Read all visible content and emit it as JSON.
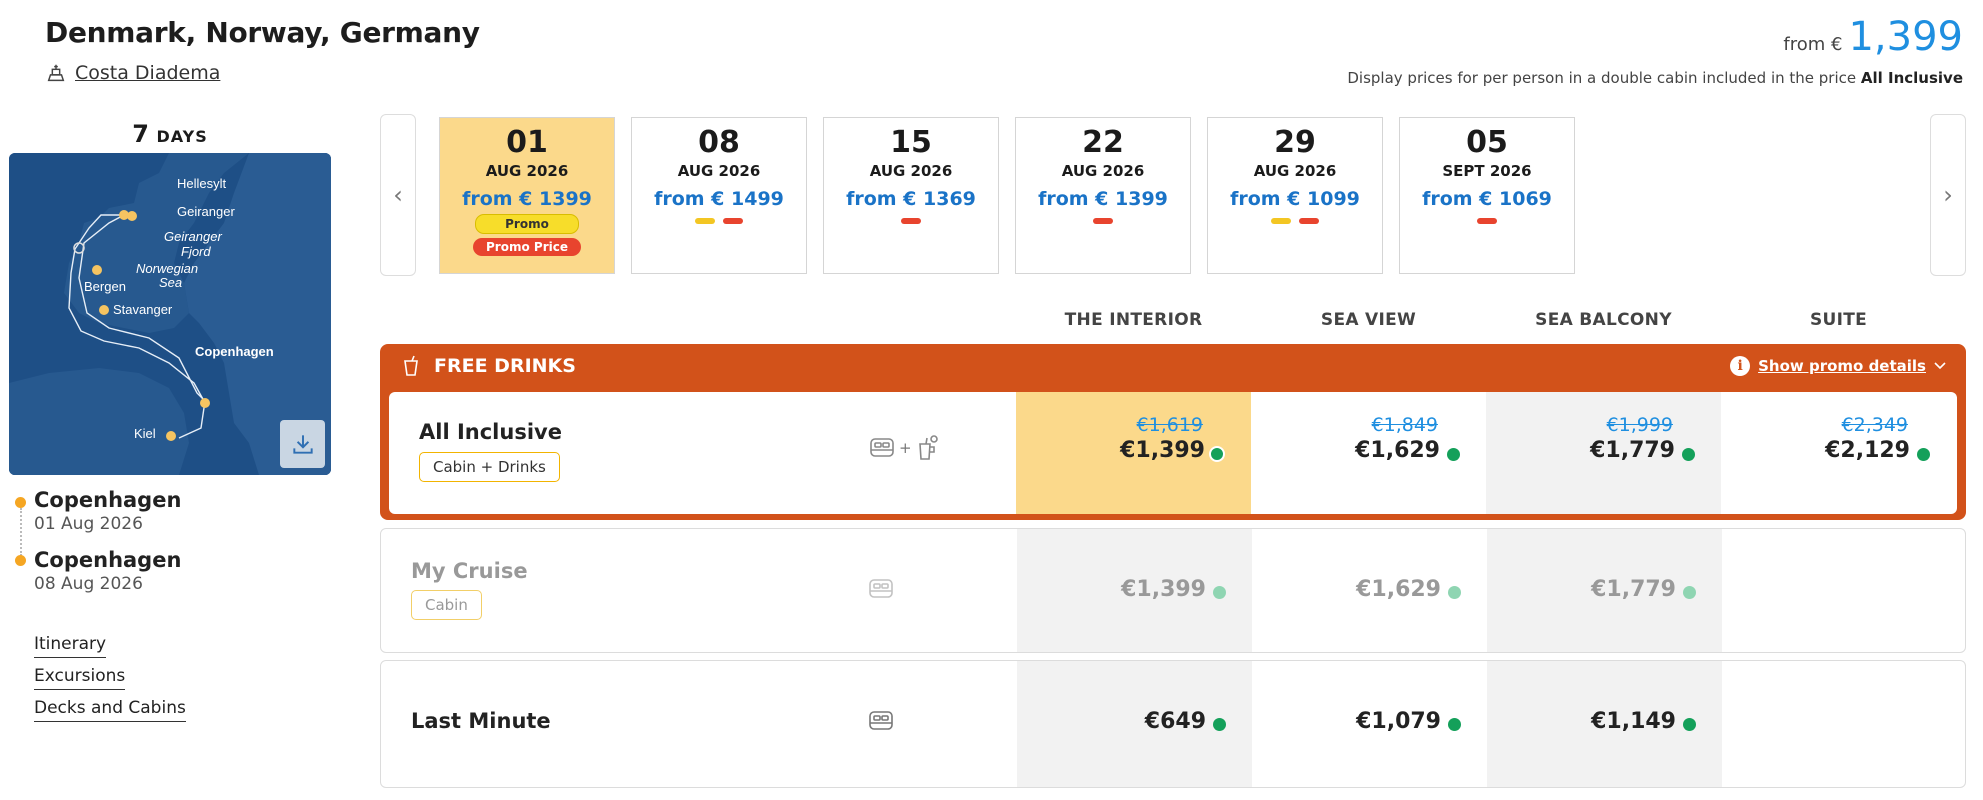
{
  "header": {
    "title": "Denmark, Norway, Germany",
    "ship": "Costa Diadema",
    "from_label": "from €",
    "from_amount": "1,399",
    "disclaimer": "Display prices for per person in a double cabin included in the price",
    "disclaimer_bold": "All Inclusive"
  },
  "sidebar": {
    "days_num": "7",
    "days_label": "DAYS",
    "map_labels": [
      "Hellesylt",
      "Geiranger",
      "Geiranger",
      "Fjord",
      "Norwegian",
      "Sea",
      "Bergen",
      "Stavanger",
      "Copenhagen",
      "Kiel"
    ],
    "departure": {
      "city": "Copenhagen",
      "date": "01 Aug 2026"
    },
    "arrival": {
      "city": "Copenhagen",
      "date": "08 Aug 2026"
    },
    "links": [
      "Itinerary",
      "Excursions",
      "Decks and Cabins"
    ]
  },
  "dates": [
    {
      "day": "01",
      "month": "AUG 2026",
      "price": "from € 1399",
      "promo": "Promo",
      "promo_price": "Promo Price",
      "active": true
    },
    {
      "day": "08",
      "month": "AUG 2026",
      "price": "from € 1499",
      "marks": [
        "y",
        "r"
      ]
    },
    {
      "day": "15",
      "month": "AUG 2026",
      "price": "from € 1369",
      "marks": [
        "r"
      ]
    },
    {
      "day": "22",
      "month": "AUG 2026",
      "price": "from € 1399",
      "marks": [
        "r"
      ]
    },
    {
      "day": "29",
      "month": "AUG 2026",
      "price": "from € 1099",
      "marks": [
        "y",
        "r"
      ]
    },
    {
      "day": "05",
      "month": "SEPT 2026",
      "price": "from € 1069",
      "marks": [
        "r"
      ]
    }
  ],
  "columns": [
    "THE INTERIOR",
    "SEA VIEW",
    "SEA BALCONY",
    "SUITE"
  ],
  "promo_block": {
    "title": "FREE DRINKS",
    "details_link": "Show promo details"
  },
  "fares": [
    {
      "name": "All Inclusive",
      "tag": "Cabin + Drinks",
      "plus": "+",
      "old_prices": [
        "€1,619",
        "€1,849",
        "€1,999",
        "€2,349"
      ],
      "prices": [
        "€1,399",
        "€1,629",
        "€1,779",
        "€2,129"
      ]
    },
    {
      "name": "My Cruise",
      "tag": "Cabin",
      "prices": [
        "€1,399",
        "€1,629",
        "€1,779"
      ]
    },
    {
      "name": "Last Minute",
      "prices": [
        "€649",
        "€1,079",
        "€1,149"
      ]
    }
  ],
  "colors": {
    "accent_blue": "#1f8fe0",
    "promo_orange": "#d2521a",
    "highlight_gold": "#fbd98b",
    "available_green": "#14a05a"
  }
}
